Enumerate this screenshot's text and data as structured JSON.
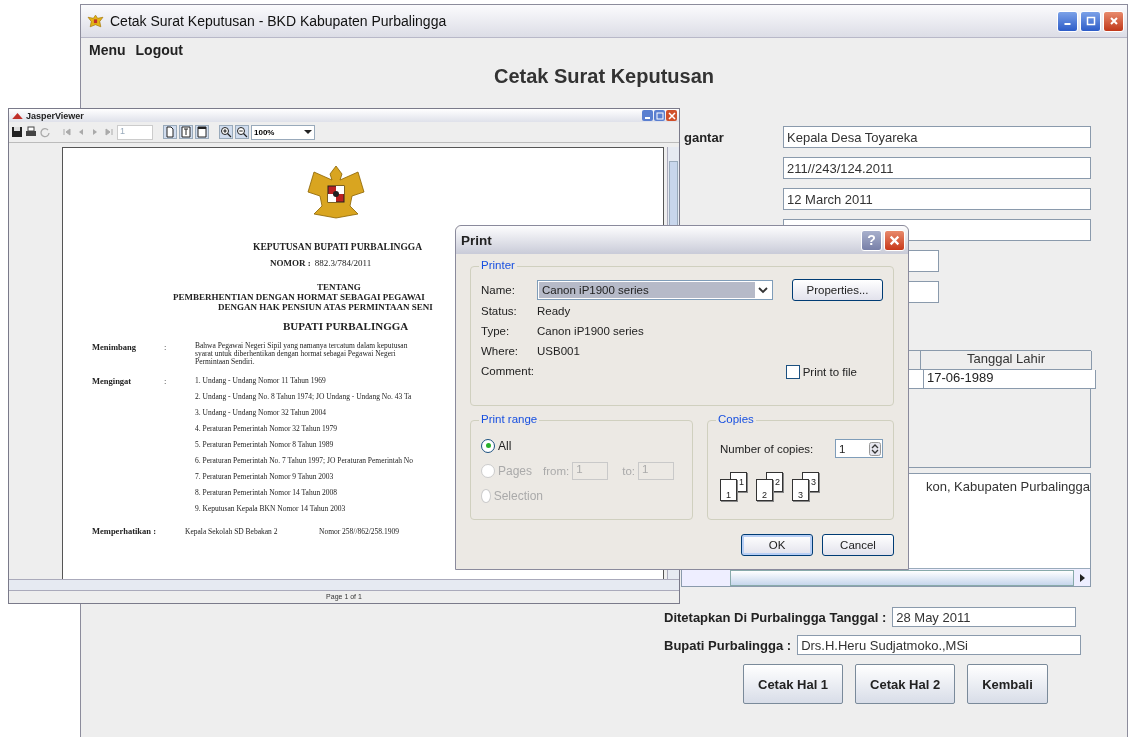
{
  "main_window": {
    "title": "Cetak Surat Keputusan - BKD Kabupaten Purbalingga",
    "menu": [
      "Menu",
      "Logout"
    ],
    "heading": "Cetak Surat Keputusan",
    "form": {
      "label": "gantar",
      "fields": [
        "Kepala Desa Toyareka",
        "211//243/124.2011",
        "12 March 2011"
      ]
    },
    "table": {
      "columns": [
        "Tanggal Lahir"
      ],
      "rows": [
        [
          "17-06-1989"
        ]
      ]
    },
    "address_text": "kon, Kabupaten Purbalingga",
    "signature": [
      {
        "label": "Ditetapkan Di Purbalingga Tanggal :",
        "value": "28 May 2011"
      },
      {
        "label": "Bupati Purbalingga :",
        "value": "Drs.H.Heru Sudjatmoko.,MSi"
      }
    ],
    "buttons": [
      "Cetak Hal 1",
      "Cetak Hal 2",
      "Kembali"
    ]
  },
  "viewer": {
    "title": "JasperViewer",
    "page_field": "1",
    "zoom": "100%",
    "status": "Page 1 of 1",
    "document": {
      "title": "KEPUTUSAN BUPATI PURBALINGGA",
      "number_label": "NOMOR :",
      "number": "882.3/784/2011",
      "about": "TENTANG",
      "subject": [
        "PEMBERHENTIAN DENGAN HORMAT SEBAGAI PEGAWAI",
        "DENGAN HAK PENSIUN ATAS PERMINTAAN SENI"
      ],
      "authority": "BUPATI PURBALINGGA",
      "sections": [
        {
          "kind": "paragraph",
          "label": "Menimbang",
          "colon": ":",
          "lines": [
            "Bahwa Pegawai Negeri Sipil yang namanya tercatum dalam keputusan",
            "syarat untuk diberhentikan dengan hormat sebagai Pegawai Negeri",
            "Permintaan Sendiri."
          ]
        },
        {
          "kind": "list",
          "label": "Mengingat",
          "colon": ":",
          "lines": [
            "1. Undang - Undang Nomor 11 Tahun 1969",
            "2. Undang - Undang No. 8 Tahun 1974; JO Undang - Undang No. 43 Ta",
            "3. Undang - Undang Nomor 32 Tahun 2004",
            "4. Peraturan Pemerintah Nomor 32 Tahun 1979",
            "5. Peraturan Pemerintah Nomor 8 Tahun 1989",
            "6. Peraturan Pemerintah No. 7 Tahun 1997; JO Peraturan Pemerintah No",
            "7. Peraturan Pemerintah Nomor 9 Tahun 2003",
            "8. Peraturan Pemerintah Nomor 14 Tahun 2008",
            "9. Keputusan Kepala BKN Nomor 14 Tahun 2003"
          ]
        }
      ],
      "memperhatikan": {
        "label": "Memperhatikan :",
        "text": "Kepala Sekolah SD Bebakan 2",
        "number": "Nomor 258//862/258.1909"
      }
    }
  },
  "print_dialog": {
    "title": "Print",
    "help": "?",
    "printer_group": "Printer",
    "name_label": "Name:",
    "printer_name": "Canon iP1900 series",
    "properties": "Properties...",
    "info": [
      {
        "label": "Status:",
        "value": "Ready"
      },
      {
        "label": "Type:",
        "value": "Canon iP1900 series"
      },
      {
        "label": "Where:",
        "value": "USB001"
      },
      {
        "label": "Comment:"
      }
    ],
    "print_to_file": {
      "label": "Print to file",
      "checked": false
    },
    "range_group": "Print range",
    "range_options": [
      {
        "label": "All",
        "selected": true,
        "disabled": false
      },
      {
        "label": "Pages",
        "selected": false,
        "disabled": true
      },
      {
        "label": "Selection",
        "selected": false,
        "disabled": true
      }
    ],
    "from_label": "from:",
    "from": "1",
    "to_label": "to:",
    "to": "1",
    "copies_group": "Copies",
    "copies_label": "Number of copies:",
    "copies": "1",
    "collate_pages": [
      {
        "back": "1",
        "front": "1"
      },
      {
        "back": "2",
        "front": "2"
      },
      {
        "back": "3",
        "front": "3"
      }
    ],
    "buttons": [
      "OK",
      "Cancel"
    ]
  }
}
